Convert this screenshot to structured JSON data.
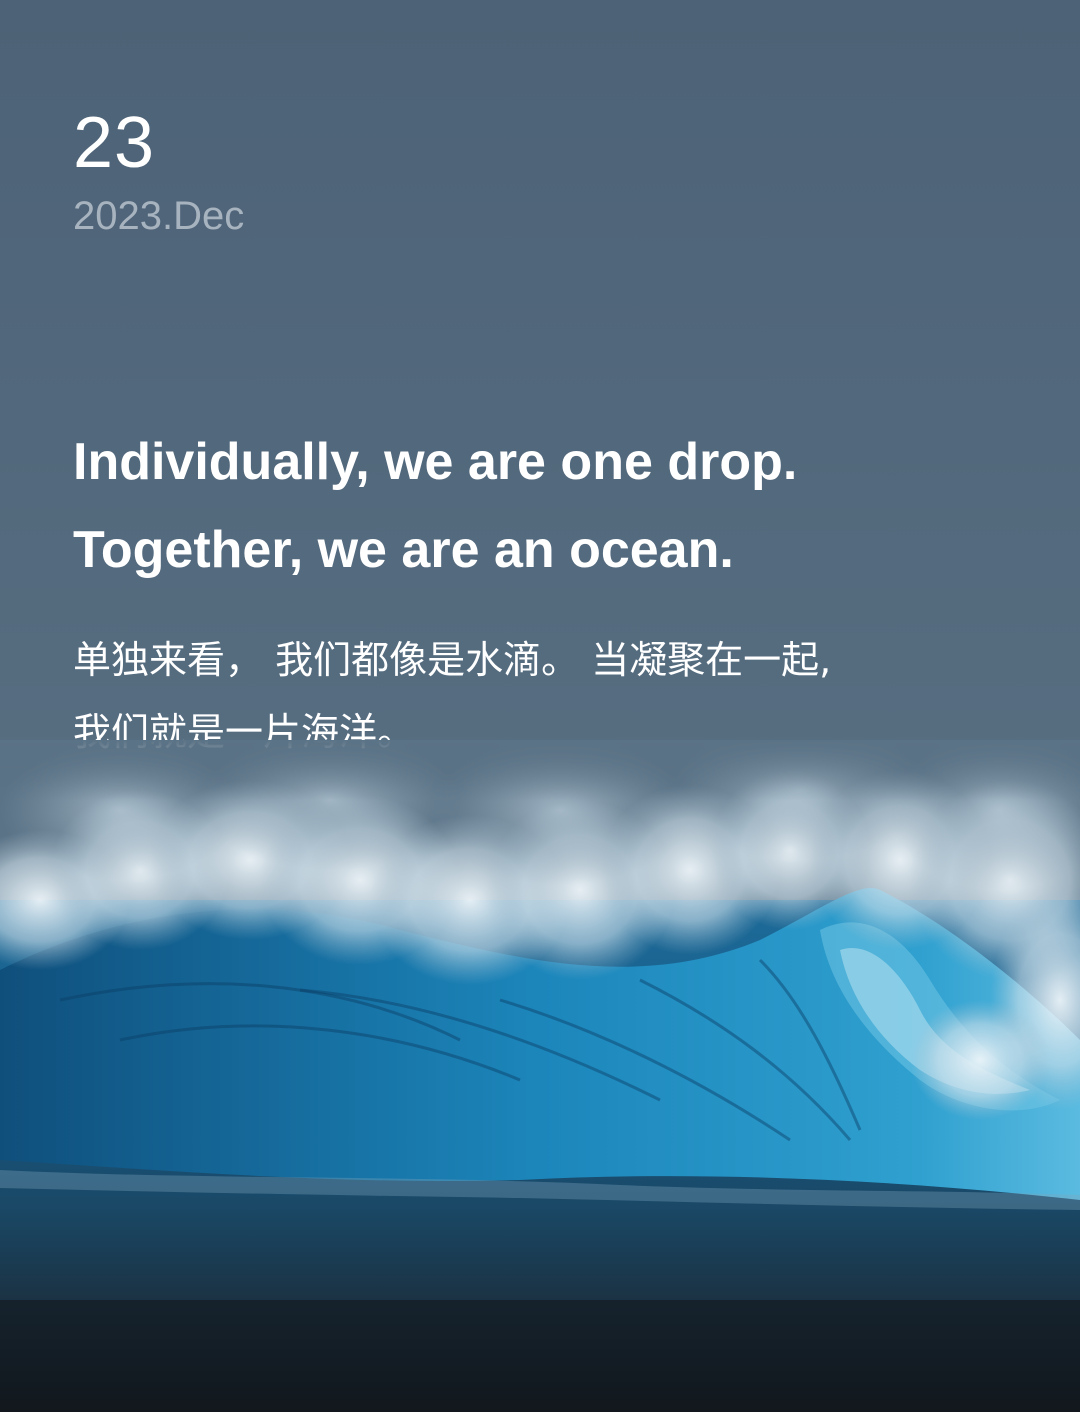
{
  "date": {
    "day": "23",
    "month_year": "2023.Dec"
  },
  "quote": {
    "english_lines": [
      "Individually, we are one drop.",
      "Together, we are an ocean."
    ],
    "chinese_lines": [
      "单独来看， 我们都像是水滴。 当凝聚在一起,",
      "我们就是一片海洋。"
    ]
  },
  "image": {
    "icon": "ocean-wave-photo",
    "colors": {
      "sky": "#52687c",
      "wave_deep": "#0b3d63",
      "wave_mid": "#1f7fb4",
      "foam": "#e8f1f6",
      "sea_bottom": "#15202b"
    }
  }
}
